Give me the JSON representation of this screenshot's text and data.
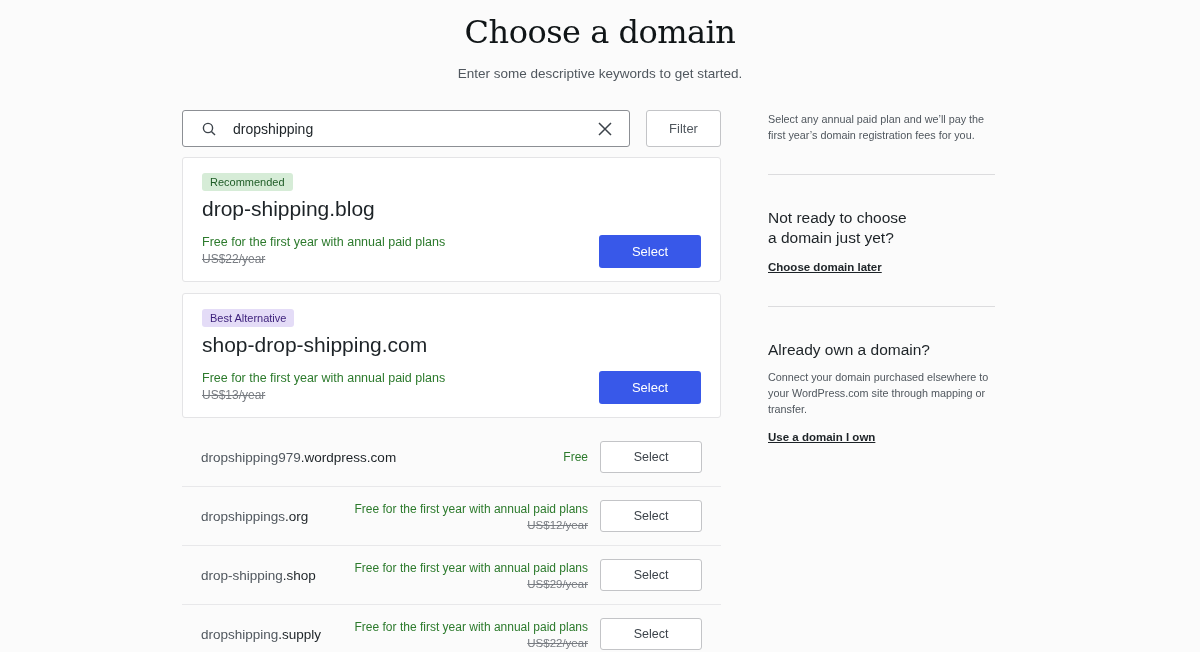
{
  "header": {
    "title": "Choose a domain",
    "subtitle": "Enter some descriptive keywords to get started."
  },
  "search": {
    "value": "dropshipping",
    "filter_label": "Filter"
  },
  "featured": [
    {
      "badge": {
        "label": "Recommended",
        "kind": "recommended"
      },
      "domain": "drop-shipping.blog",
      "offer": "Free for the first year with annual paid plans",
      "old_price": "US$22/year",
      "button": "Select"
    },
    {
      "badge": {
        "label": "Best Alternative",
        "kind": "alternative"
      },
      "domain": "shop-drop-shipping.com",
      "offer": "Free for the first year with annual paid plans",
      "old_price": "US$13/year",
      "button": "Select"
    }
  ],
  "results": [
    {
      "name": "dropshipping979",
      "tld": ".wordpress.com",
      "offer": "Free",
      "button": "Select"
    },
    {
      "name": "dropshippings",
      "tld": ".org",
      "offer": "Free for the first year with annual paid plans",
      "old_price": "US$12/year",
      "button": "Select"
    },
    {
      "name": "drop-shipping",
      "tld": ".shop",
      "offer": "Free for the first year with annual paid plans",
      "old_price": "US$29/year",
      "button": "Select"
    },
    {
      "name": "dropshipping",
      "tld": ".supply",
      "offer": "Free for the first year with annual paid plans",
      "old_price": "US$22/year",
      "button": "Select"
    }
  ],
  "sidebar": {
    "intro": "Select any annual paid plan and we’ll pay the first year’s domain registration fees for you.",
    "sections": [
      {
        "heading": "Not ready to choose\na domain just yet?",
        "link": "Choose domain later"
      },
      {
        "heading": "Already own a domain?",
        "text": "Connect your domain purchased elsewhere to your WordPress.com site through mapping or transfer.",
        "link": "Use a domain I own"
      }
    ]
  }
}
